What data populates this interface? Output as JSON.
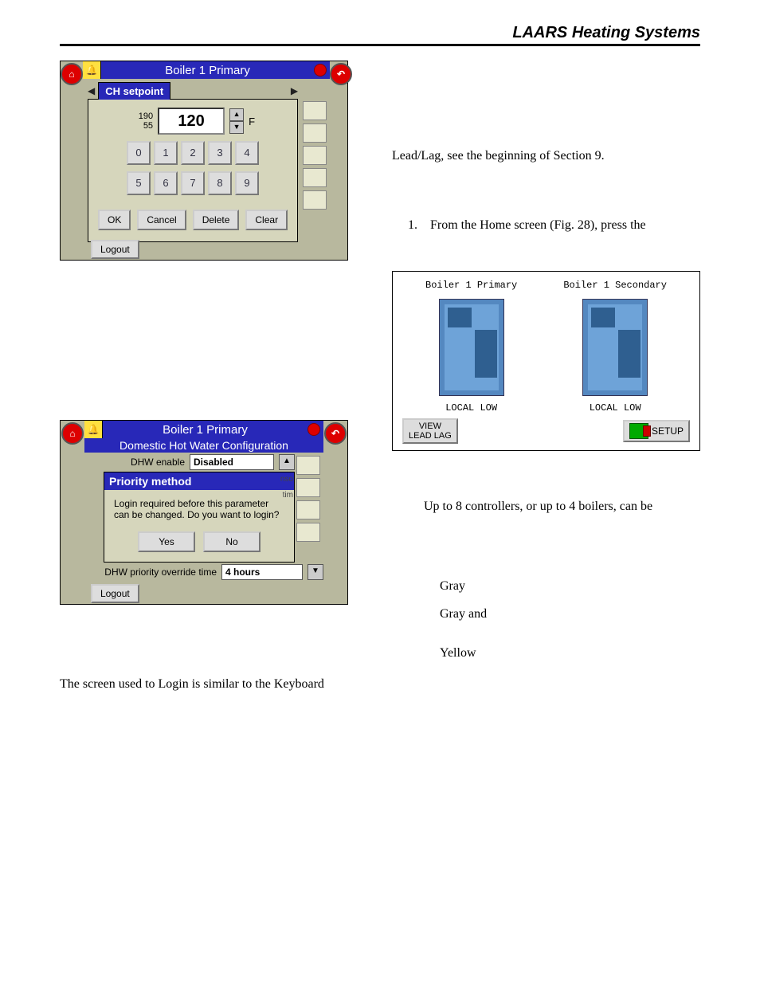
{
  "header": {
    "brand": "LAARS Heating Systems"
  },
  "fig1": {
    "title": "Boiler 1 Primary",
    "tab": "CH setpoint",
    "max": "190",
    "min": "55",
    "value": "120",
    "unit": "F",
    "keys_row1": [
      "0",
      "1",
      "2",
      "3",
      "4"
    ],
    "keys_row2": [
      "5",
      "6",
      "7",
      "8",
      "9"
    ],
    "btn_ok": "OK",
    "btn_cancel": "Cancel",
    "btn_delete": "Delete",
    "btn_clear": "Clear",
    "logout": "Logout"
  },
  "fig2": {
    "title": "Boiler 1 Primary",
    "subtitle": "Domestic Hot Water Configuration",
    "dhw_enable_lbl": "DHW enable",
    "dhw_enable_val": "Disabled",
    "popup_title": "Priority method",
    "popup_msg": "Login required before this parameter can be changed. Do you want to login?",
    "yes": "Yes",
    "no": "No",
    "ghost1": "nso",
    "ghost2": "tim",
    "override_lbl": "DHW priority override time",
    "override_val": "4 hours",
    "logout": "Logout"
  },
  "fig3": {
    "dev1_name": "Boiler 1 Primary",
    "dev1_status": "LOCAL LOW",
    "dev2_name": "Boiler 1 Secondary",
    "dev2_status": "LOCAL LOW",
    "view_btn": "VIEW\nLEAD LAG",
    "setup_btn": "SETUP"
  },
  "text": {
    "t1": "Lead/Lag, see the beginning of Section 9.",
    "step1_n": "1.",
    "step1": "From the Home screen (Fig. 28), press the",
    "t2": "Up to 8 controllers, or up to 4 boilers, can be",
    "c1": "Gray",
    "c2": "Gray and",
    "c3": "Yellow",
    "t3": "The screen used to Login is similar to the Keyboard"
  }
}
